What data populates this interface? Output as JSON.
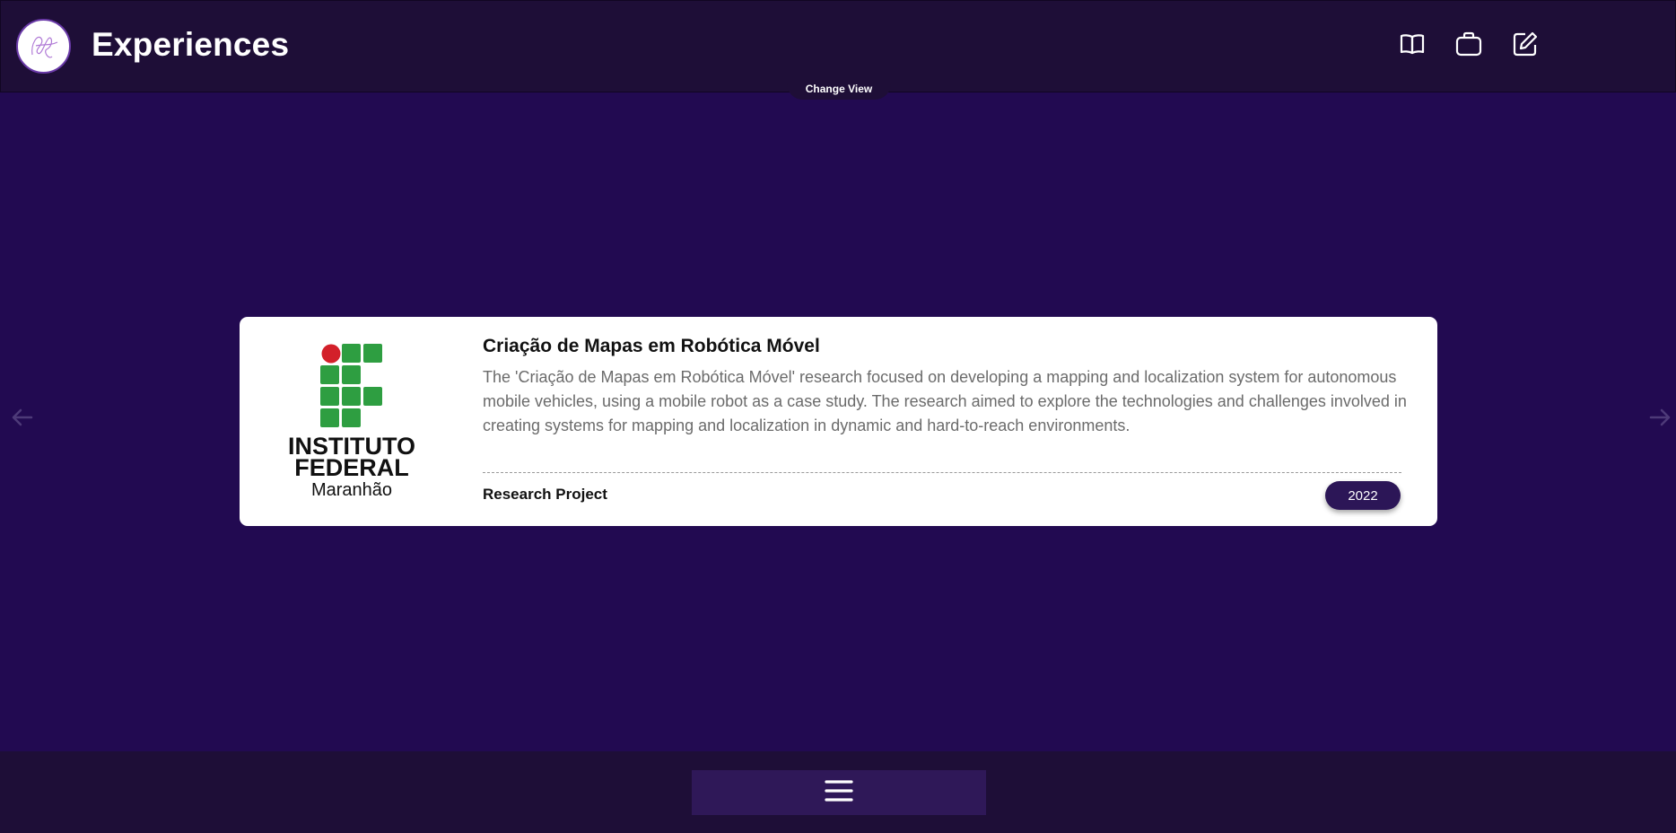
{
  "header": {
    "title": "Experiences",
    "avatar_icon": "signature-logo-icon",
    "nav_icons": [
      "book-open-icon",
      "briefcase-icon",
      "edit-note-icon"
    ]
  },
  "change_view": {
    "label": "Change View"
  },
  "navigation": {
    "prev_icon": "arrow-left-icon",
    "next_icon": "arrow-right-icon"
  },
  "card": {
    "logo": {
      "line1": "INSTITUTO",
      "line2": "FEDERAL",
      "line3": "Maranhão"
    },
    "title": "Criação de Mapas em Robótica Móvel",
    "description": "The 'Criação de Mapas em Robótica Móvel' research focused on developing a mapping and localization system for autonomous mobile vehicles, using a mobile robot as a case study. The research aimed to explore the technologies and challenges involved in creating systems for mapping and localization in dynamic and hard-to-reach environments.",
    "type": "Research Project",
    "year": "2022"
  },
  "footer": {
    "menu_icon": "hamburger-menu-icon"
  },
  "colors": {
    "background": "#220a51",
    "header": "#1e0e37",
    "badge": "#2c1657",
    "logo_green": "#2e9e41",
    "logo_red": "#d3202a"
  }
}
